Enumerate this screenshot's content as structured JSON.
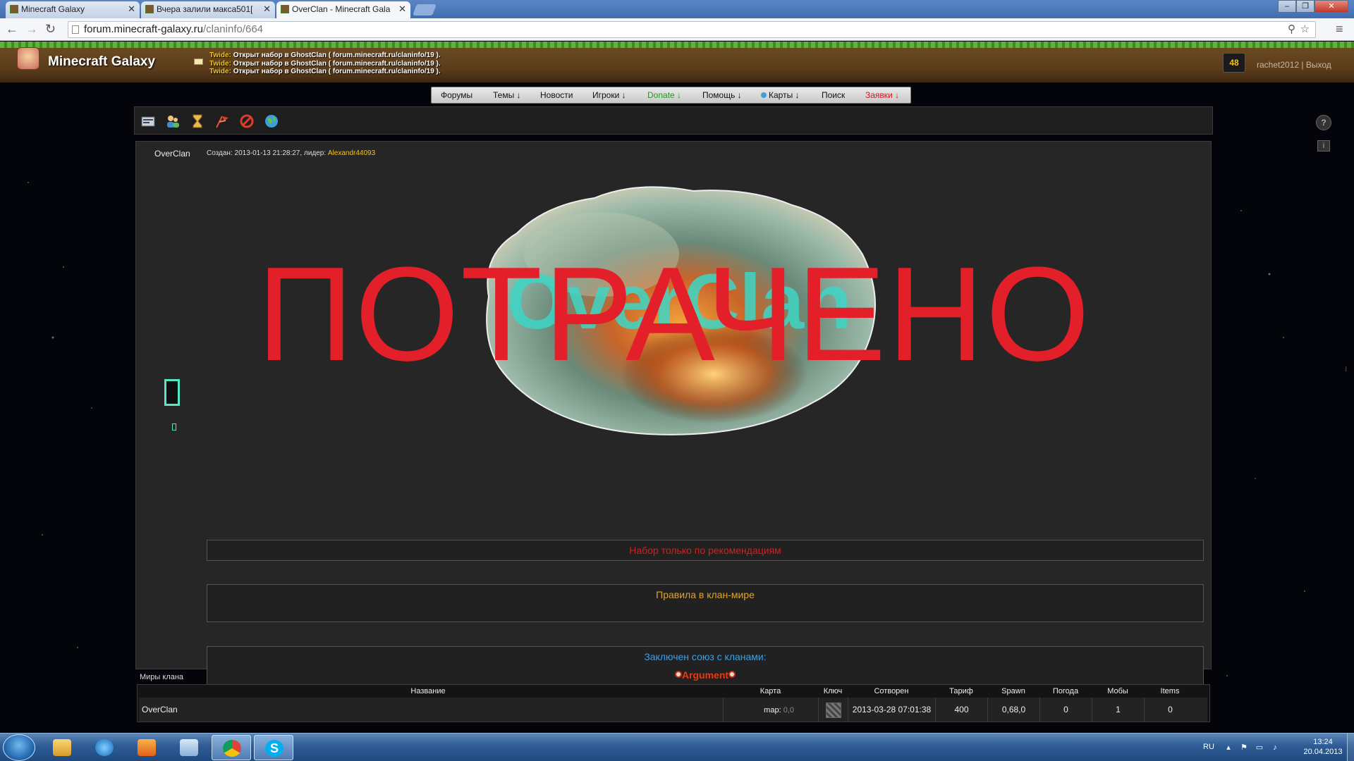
{
  "browser": {
    "tabs": [
      {
        "title": "Minecraft Galaxy",
        "active": false
      },
      {
        "title": "Вчера залили макса501[",
        "active": false
      },
      {
        "title": "OverClan - Minecraft Gala",
        "active": true
      }
    ],
    "url_host": "forum.minecraft-galaxy.ru",
    "url_path": "/claninfo/664"
  },
  "site": {
    "logo_text": "Minecraft Galaxy",
    "news": [
      {
        "author": "Twide:",
        "text": " Открыт набор в GhostClan ( forum.minecraft.ru/claninfo/19 )."
      },
      {
        "author": "Twide:",
        "text": " Открыт набор в GhostClan ( forum.minecraft.ru/claninfo/19 )."
      },
      {
        "author": "Twide:",
        "text": " Открыт набор в GhostClan ( forum.minecraft.ru/claninfo/19 )."
      }
    ],
    "message_count": "48",
    "username": "rachet2012",
    "separator": " | ",
    "logout": "Выход"
  },
  "nav": [
    {
      "label": "Форумы"
    },
    {
      "label": "Темы ↓"
    },
    {
      "label": "Новости"
    },
    {
      "label": "Игроки ↓"
    },
    {
      "label": "Donate ↓"
    },
    {
      "label": "Помощь ↓"
    },
    {
      "label": "Карты ↓"
    },
    {
      "label": "Поиск"
    },
    {
      "label": "Заявки ↓"
    }
  ],
  "clan": {
    "name": "OverClan",
    "created_prefix": "Создан: ",
    "created": "2013-01-13 21:28:27",
    "leader_prefix": ", лидер: ",
    "leader": "Alexandr44093",
    "banner_text": "OverClan",
    "stamp": "ПОТРАЧЕНО",
    "recruit": "Набор только по рекомендациям",
    "rules_title": "Правила в клан-мире",
    "alliance_title": "Заключен союз с кланами:",
    "ally": "Argument"
  },
  "worlds": {
    "title": "Миры клана",
    "headers": {
      "name": "Название",
      "map": "Карта",
      "key": "Ключ",
      "created": "Сотворен",
      "tariff": "Тариф",
      "spawn": "Spawn",
      "weather": "Погода",
      "mobs": "Мобы",
      "items": "Items"
    },
    "row": {
      "name": "OverClan",
      "map_label": "map:",
      "map_coords": " 0,0",
      "created": "2013-03-28 07:01:38",
      "tariff": "400",
      "spawn": "0,68,0",
      "weather": "0",
      "mobs": "1",
      "items": "0"
    }
  },
  "taskbar": {
    "lang": "RU",
    "time": "13:24",
    "date": "20.04.2013"
  },
  "colors": {
    "stamp": "#e3202a",
    "leader": "#f5c518",
    "recruit": "#d22020",
    "rules": "#e0a42c",
    "alliance": "#3aa0e8",
    "ally": "#e83a0e",
    "donate": "#1aa01a",
    "requests": "#d01818"
  }
}
